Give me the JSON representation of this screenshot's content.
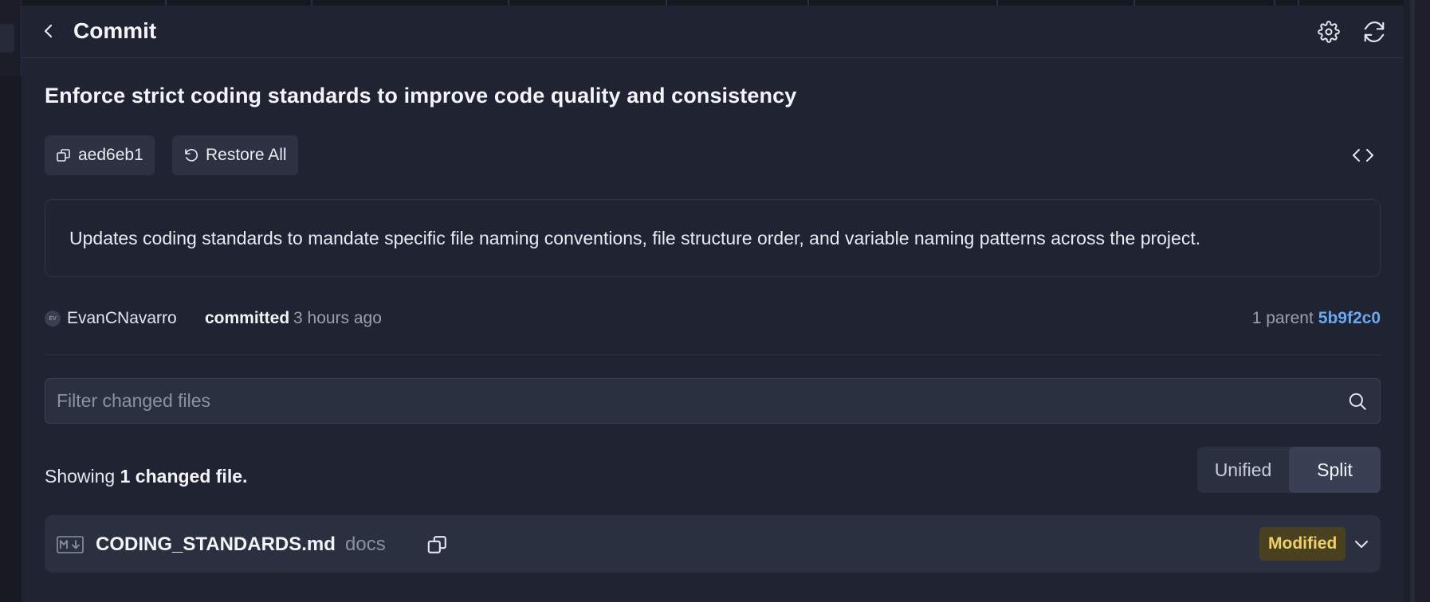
{
  "header": {
    "title": "Commit"
  },
  "commit": {
    "title": "Enforce strict coding standards to improve code quality and consistency",
    "hash": "aed6eb1",
    "restore_label": "Restore All",
    "description": "Updates coding standards to mandate specific file naming conventions, file structure order, and variable naming patterns across the project.",
    "author": {
      "avatar_initials": "EV",
      "name": "EvanCNavarro",
      "action": "committed",
      "time_ago": "3 hours ago"
    },
    "parents": {
      "label": "1 parent",
      "hash": "5b9f2c0"
    }
  },
  "filter": {
    "placeholder": "Filter changed files",
    "value": ""
  },
  "summary": {
    "prefix": "Showing",
    "count_text": "1 changed file."
  },
  "view_toggle": {
    "options": [
      "Unified",
      "Split"
    ],
    "selected": "Split"
  },
  "files": [
    {
      "name": "CODING_STANDARDS.md",
      "directory": "docs",
      "status": "Modified",
      "icon": "markdown-icon"
    }
  ],
  "colors": {
    "background": "#1f2332",
    "link": "#6ba8f0",
    "modified_badge_bg": "#4a4120",
    "modified_badge_text": "#f0cf6a"
  },
  "icons": {
    "back": "chevron-left-icon",
    "settings": "gear-icon",
    "refresh": "refresh-icon",
    "copy": "copy-icon",
    "restore": "restore-icon",
    "code": "code-brackets-icon",
    "search": "search-icon",
    "expand": "chevron-down-icon"
  }
}
